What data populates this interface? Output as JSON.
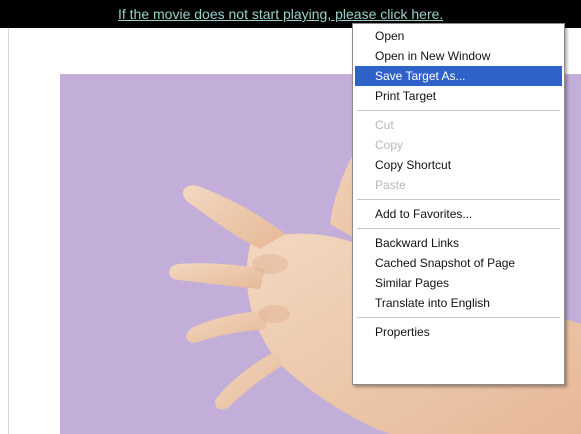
{
  "banner": {
    "link_text": "If the movie does not start playing, please click here."
  },
  "context_menu": {
    "groups": [
      [
        {
          "label": "Open",
          "state": "normal"
        },
        {
          "label": "Open in New Window",
          "state": "normal"
        },
        {
          "label": "Save Target As...",
          "state": "highlighted"
        },
        {
          "label": "Print Target",
          "state": "normal"
        }
      ],
      [
        {
          "label": "Cut",
          "state": "disabled"
        },
        {
          "label": "Copy",
          "state": "disabled"
        },
        {
          "label": "Copy Shortcut",
          "state": "normal"
        },
        {
          "label": "Paste",
          "state": "disabled"
        }
      ],
      [
        {
          "label": "Add to Favorites...",
          "state": "normal"
        }
      ],
      [
        {
          "label": "Backward Links",
          "state": "normal"
        },
        {
          "label": "Cached Snapshot of Page",
          "state": "normal"
        },
        {
          "label": "Similar Pages",
          "state": "normal"
        },
        {
          "label": "Translate into English",
          "state": "normal"
        }
      ],
      [
        {
          "label": "Properties",
          "state": "normal"
        }
      ]
    ]
  },
  "colors": {
    "video_background": "#c2aed8",
    "highlight": "#2f62c8",
    "link": "#9ad0c8"
  }
}
